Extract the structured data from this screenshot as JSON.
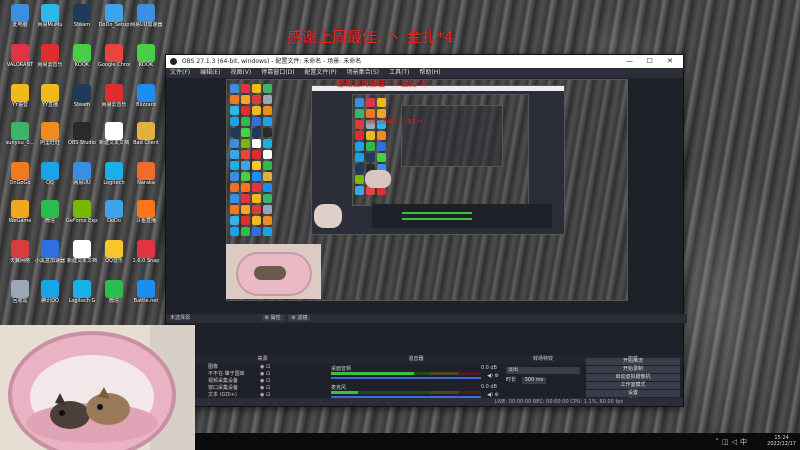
{
  "overlay": {
    "thanks_text": "感谢上周最佳: 丶 金扎*4",
    "nested_thanks_a": "感谢上周最佳: 丶 金扎*4",
    "nested_thanks_b": "感谢上周最佳: 丶 金扎*4"
  },
  "desktop": {
    "icons": [
      {
        "label": "此电脑",
        "color": "#3b8fe0"
      },
      {
        "label": "VALORANT",
        "color": "#e03344"
      },
      {
        "label": "YY语音",
        "color": "#f0b91c"
      },
      {
        "label": "sunyou_0...",
        "color": "#3db36a"
      },
      {
        "label": "OnGoGo",
        "color": "#f07a1c"
      },
      {
        "label": "WeGame",
        "color": "#f0a822"
      },
      {
        "label": "天翼网络",
        "color": "#d83c3c"
      },
      {
        "label": "回收站",
        "color": "#9aa7b8"
      },
      {
        "label": "网易MuMu",
        "color": "#2fb7ea"
      },
      {
        "label": "网易云音乐",
        "color": "#e02e2e"
      },
      {
        "label": "YY直播",
        "color": "#f0b91c"
      },
      {
        "label": "阿里旺旺",
        "color": "#f08c1c"
      },
      {
        "label": "QQ",
        "color": "#1aa4e8"
      },
      {
        "label": "微信",
        "color": "#2dbb4f"
      },
      {
        "label": "小黑盒加速器",
        "color": "#2f6fe0"
      },
      {
        "label": "腾讯QQ",
        "color": "#1aa4e8"
      },
      {
        "label": "Steam",
        "color": "#203a5c"
      },
      {
        "label": "KOOK",
        "color": "#45d048"
      },
      {
        "label": "Steam",
        "color": "#203a5c"
      },
      {
        "label": "OBS Studio",
        "color": "#2a2a2a"
      },
      {
        "label": "网易UU",
        "color": "#3b8fe0"
      },
      {
        "label": "GeForce Experience",
        "color": "#76b900"
      },
      {
        "label": "新建文本文档",
        "color": "#ffffff"
      },
      {
        "label": "Logitech G",
        "color": "#1ab0e6"
      },
      {
        "label": "DoDo_Setup",
        "color": "#3da4ea"
      },
      {
        "label": "Google Chrome",
        "color": "#e8453c"
      },
      {
        "label": "网易云音乐",
        "color": "#e02e2e"
      },
      {
        "label": "新建文本文档",
        "color": "#ffffff"
      },
      {
        "label": "Logitech",
        "color": "#1ab0e6"
      },
      {
        "label": "DoDo",
        "color": "#3da4ea"
      },
      {
        "label": "QQ音乐",
        "color": "#f7c52c"
      },
      {
        "label": "微信",
        "color": "#2dbb4f"
      },
      {
        "label": "网易UU加速器",
        "color": "#3b8fe0"
      },
      {
        "label": "KOOK",
        "color": "#45d048"
      },
      {
        "label": "Blizzard",
        "color": "#1c8ef0"
      },
      {
        "label": "Bad Client",
        "color": "#e0b040"
      },
      {
        "label": "Naraka",
        "color": "#f06b2c"
      },
      {
        "label": "斗鱼直播",
        "color": "#ff7418"
      },
      {
        "label": "1.6.0 Snap",
        "color": "#e03344"
      },
      {
        "label": "Battle.net",
        "color": "#1c8ef0"
      }
    ]
  },
  "obs": {
    "title": "OBS 27.1.3 (64-bit, windows) - 配置文件: 未命名 - 场景: 未命名",
    "window_controls": [
      "—",
      "☐",
      "✕"
    ],
    "menu": [
      "文件(F)",
      "编辑(E)",
      "视图(V)",
      "停靠窗口(D)",
      "配置文件(P)",
      "场景集合(S)",
      "工具(T)",
      "帮助(H)"
    ],
    "preview_label": "未选择源",
    "scene_toolbar": [
      "⚙ 属性",
      "⚙ 滤镜"
    ],
    "docks": {
      "scenes": "场景",
      "sources": "来源",
      "mixer": "混音器",
      "transitions": "转场特效",
      "controls": "控件"
    },
    "sources": [
      {
        "name": "图像"
      },
      {
        "name": "不不在·肇于国库"
      },
      {
        "name": "视频采集设备"
      },
      {
        "name": "窗口采集设备"
      },
      {
        "name": "文本 (GDI+)"
      },
      {
        "name": "文本 (GDI+)"
      }
    ],
    "mixer": [
      {
        "name": "桌面音频",
        "db": "0.0 dB",
        "level": 0.55
      },
      {
        "name": "麦克风",
        "db": "0.0 dB",
        "level": 0.18
      }
    ],
    "transition": {
      "selected": "淡出",
      "duration_label": "时长",
      "duration_value": "300 ms"
    },
    "controls": [
      "开始推流",
      "开始录制",
      "启动虚拟摄像机",
      "工作室模式",
      "设置",
      "退出"
    ],
    "status_bar": "LIVE: 00:00:00   REC: 00:00:00   CPU: 1.1%, 60.00 fps"
  },
  "taskbar": {
    "time": "15:24",
    "date": "2022/12/17"
  },
  "colors": {
    "obs_bg": "#2b2e38",
    "overlay_red": "#ff1f1f",
    "meter_green": "#3fbf3f",
    "meter_yellow": "#d8c03a",
    "meter_red": "#d83c3c"
  }
}
